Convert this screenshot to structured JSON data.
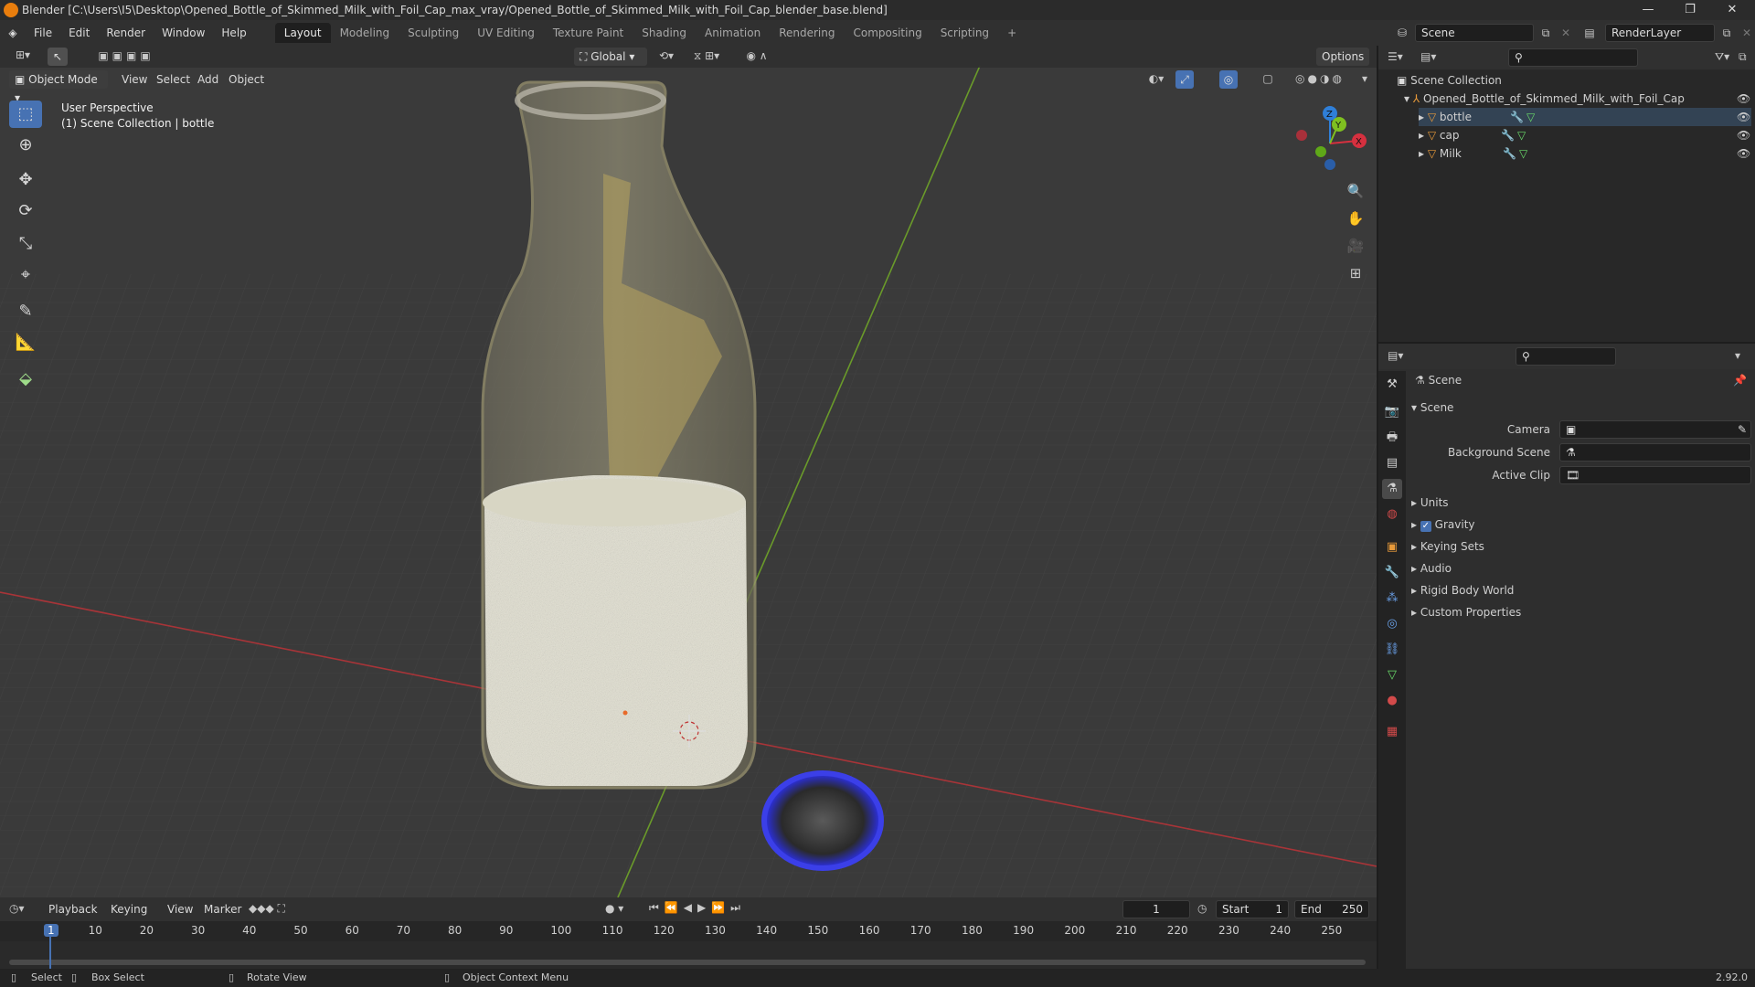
{
  "window": {
    "title": "Blender [C:\\Users\\I5\\Desktop\\Opened_Bottle_of_Skimmed_Milk_with_Foil_Cap_max_vray/Opened_Bottle_of_Skimmed_Milk_with_Foil_Cap_blender_base.blend]",
    "minimize": "—",
    "maximize": "❐",
    "close": "✕"
  },
  "menu": [
    "File",
    "Edit",
    "Render",
    "Window",
    "Help"
  ],
  "workspaces": [
    "Layout",
    "Modeling",
    "Sculpting",
    "UV Editing",
    "Texture Paint",
    "Shading",
    "Animation",
    "Rendering",
    "Compositing",
    "Scripting"
  ],
  "workspace_add": "+",
  "scene_field": "Scene",
  "renderlayer_field": "RenderLayer",
  "viewport": {
    "transform_orientation": "Global",
    "options": "Options",
    "mode": "Object Mode",
    "menus": [
      "View",
      "Select",
      "Add",
      "Object"
    ],
    "info_line1": "User Perspective",
    "info_line2": "(1) Scene Collection | bottle",
    "gizmo_labels": {
      "z": "Z",
      "y": "Y",
      "x": "X"
    }
  },
  "outliner": {
    "root": "Scene Collection",
    "collection": "Opened_Bottle_of_Skimmed_Milk_with_Foil_Cap",
    "objects": [
      "bottle",
      "cap",
      "Milk"
    ]
  },
  "properties": {
    "context": "Scene",
    "panel": "Scene",
    "fields": [
      {
        "label": "Camera",
        "value": ""
      },
      {
        "label": "Background Scene",
        "value": ""
      },
      {
        "label": "Active Clip",
        "value": ""
      }
    ],
    "subpanels": [
      "Units",
      "Gravity",
      "Keying Sets",
      "Audio",
      "Rigid Body World",
      "Custom Properties"
    ],
    "gravity_checked": true
  },
  "timeline": {
    "menus": [
      "Playback",
      "Keying",
      "View",
      "Marker"
    ],
    "current_frame": "1",
    "start_label": "Start",
    "start_value": "1",
    "end_label": "End",
    "end_value": "250",
    "ruler": [
      "1",
      "10",
      "20",
      "30",
      "40",
      "50",
      "60",
      "70",
      "80",
      "90",
      "100",
      "110",
      "120",
      "130",
      "140",
      "150",
      "160",
      "170",
      "180",
      "190",
      "200",
      "210",
      "220",
      "230",
      "240",
      "250"
    ]
  },
  "statusbar": {
    "select": "Select",
    "box_select": "Box Select",
    "rotate_view": "Rotate View",
    "context_menu": "Object Context Menu",
    "version": "2.92.0"
  },
  "colors": {
    "accent": "#4772b3",
    "x_axis": "#d6303f",
    "y_axis": "#7fc020",
    "z_axis": "#2f7fd8",
    "milk": "#e8e6d6",
    "cap": "#3a3fe0"
  }
}
